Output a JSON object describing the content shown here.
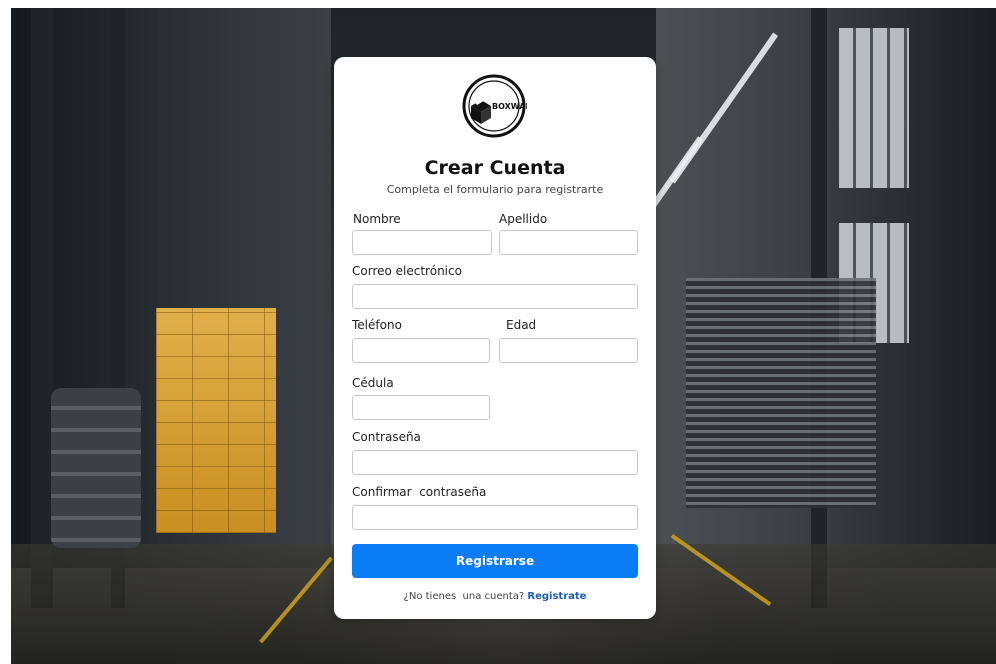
{
  "brand": {
    "logo_text": "BOXWARE"
  },
  "form": {
    "title": "Crear Cuenta",
    "subtitle": "Completa el formulario para registrarte",
    "fields": {
      "nombre": {
        "label": "Nombre",
        "value": ""
      },
      "apellido": {
        "label": "Apellido",
        "value": ""
      },
      "correo": {
        "label": "Correo electrónico",
        "value": ""
      },
      "telefono": {
        "label": "Teléfono",
        "value": ""
      },
      "edad": {
        "label": "Edad",
        "value": ""
      },
      "cedula": {
        "label": "Cédula",
        "value": ""
      },
      "contrasena": {
        "label": "Contraseña",
        "value": ""
      },
      "confirmar": {
        "label": "Confirmar  contraseña",
        "value": ""
      }
    },
    "submit_label": "Registrarse",
    "footer": {
      "question": "¿No tienes  una cuenta? ",
      "link_label": "Registrate"
    }
  },
  "colors": {
    "accent": "#0a7cf6",
    "link": "#1a5fb4",
    "card": "#ffffff"
  },
  "icons": {
    "logo": "box-logo-icon"
  }
}
